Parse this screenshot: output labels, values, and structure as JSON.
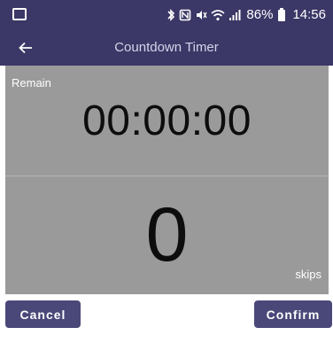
{
  "status_bar": {
    "icons": [
      "bluetooth-icon",
      "nfc-icon",
      "mute-icon",
      "wifi-icon",
      "signal-icon"
    ],
    "battery": "86%",
    "time": "14:56"
  },
  "app_bar": {
    "back_icon": "arrow-left-icon",
    "title": "Countdown Timer"
  },
  "timer": {
    "remain_label": "Remain",
    "time_value": "00:00:00",
    "skip_count": "0",
    "skip_unit": "skips"
  },
  "actions": {
    "cancel_label": "Cancel",
    "confirm_label": "Confirm"
  },
  "colors": {
    "app_bar": "#3b3766",
    "button": "#4a4779",
    "panel": "#9a9a9a"
  }
}
